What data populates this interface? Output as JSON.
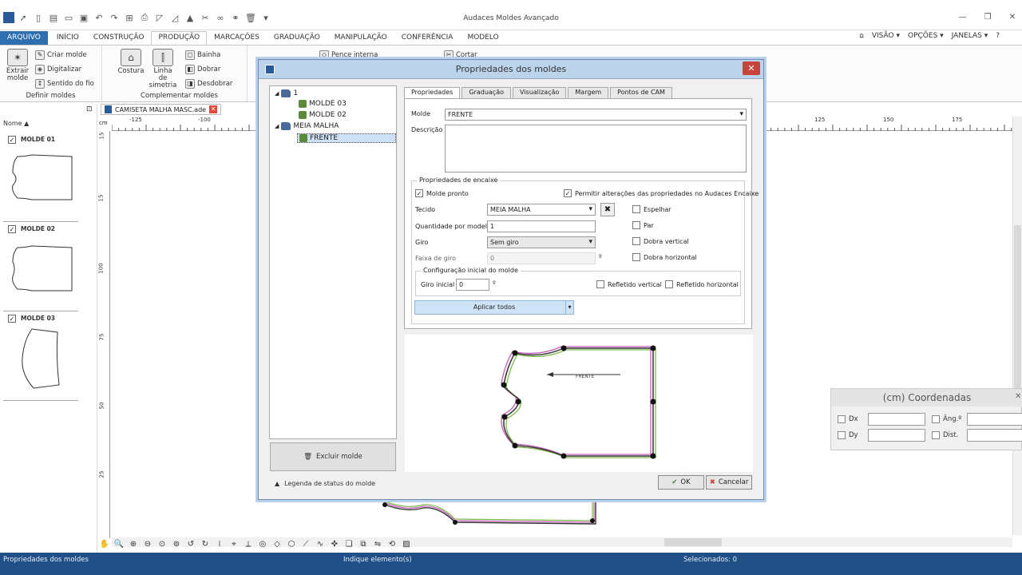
{
  "app": {
    "title": "Audaces Moldes Avançado",
    "quick_access_icons": [
      "pointer-icon",
      "new-icon",
      "open-icon",
      "folder-icon",
      "save-icon",
      "undo-icon",
      "redo-icon",
      "table-icon",
      "print-icon",
      "ruler-icon",
      "tape-icon",
      "shirt-icon",
      "scissors-icon",
      "glasses-icon",
      "link-icon",
      "delete-icon",
      "more-icon"
    ]
  },
  "ribbon": {
    "tabs": [
      "ARQUIVO",
      "INÍCIO",
      "CONSTRUÇÃO",
      "PRODUÇÃO",
      "MARCAÇÕES",
      "GRADUAÇÃO",
      "MANIPULAÇÃO",
      "CONFERÊNCIA",
      "MODELO"
    ],
    "active_tab": "PRODUÇÃO",
    "right_menu": [
      "VISÃO ▾",
      "OPÇÕES ▾",
      "JANELAS ▾"
    ],
    "groups": {
      "definir": {
        "label": "Definir moldes",
        "extrair": "Extrair molde",
        "criar": "Criar molde",
        "digitalizar": "Digitalizar",
        "sentido": "Sentido do fio"
      },
      "complementar": {
        "label": "Complementar moldes",
        "costura": "Costura",
        "simetria": "Linha de simetria",
        "bainha": "Bainha",
        "dobrar": "Dobrar",
        "desdobrar": "Desdobrar"
      },
      "extra": {
        "pence": "Pence interna",
        "cortar": "Cortar"
      }
    }
  },
  "document_tab": "CAMISETA MALHA MASC.ade",
  "left_panel": {
    "header": "Nome",
    "moldes": [
      {
        "label": "MOLDE 01",
        "checked": true
      },
      {
        "label": "MOLDE 02",
        "checked": true
      },
      {
        "label": "MOLDE 03",
        "checked": true
      }
    ]
  },
  "ruler": {
    "h_ticks": [
      "-125",
      "-100",
      "125",
      "150",
      "175"
    ],
    "v_ticks": [
      "15",
      "100",
      "75",
      "50",
      "25"
    ]
  },
  "coordinates": {
    "title": "(cm) Coordenadas",
    "dx": "Dx",
    "dy": "Dy",
    "ang": "Âng.º",
    "dist": "Dist."
  },
  "dialog": {
    "title": "Propriedades dos moldes",
    "tree": {
      "group1": "1",
      "molde03": "MOLDE 03",
      "molde02": "MOLDE 02",
      "group2": "MEIA MALHA",
      "frente": "FRENTE"
    },
    "excluir": "Excluir molde",
    "legenda": "Legenda de status do molde",
    "tabs": [
      "Propriedades",
      "Graduação",
      "Visualização",
      "Margem",
      "Pontos de CAM"
    ],
    "active_tab": "Propriedades",
    "molde_label": "Molde",
    "molde_value": "FRENTE",
    "descricao_label": "Descrição",
    "encaixe_title": "Propriedades de encaixe",
    "molde_pronto": "Molde pronto",
    "permitir": "Permitir alterações das propriedades no Audaces Encaixe",
    "tecido_label": "Tecido",
    "tecido_value": "MEIA MALHA",
    "quantidade_label": "Quantidade por modelo",
    "quantidade_value": "1",
    "giro_label": "Giro",
    "giro_value": "Sem giro",
    "faixa_label": "Faixa de giro",
    "faixa_value": "0",
    "degree": "º",
    "espelhar": "Espelhar",
    "par": "Par",
    "dobra_vertical": "Dobra vertical",
    "dobra_horizontal": "Dobra horizontal",
    "config_title": "Configuração inicial do molde",
    "giro_inicial_label": "Giro inicial",
    "giro_inicial_value": "0",
    "refletido_vertical": "Refletido vertical",
    "refletido_horizontal": "Refletido horizontal",
    "aplicar": "Aplicar todos",
    "preview_label": "FRENTE",
    "ok": "OK",
    "cancel": "Cancelar"
  },
  "status": {
    "left": "Propriedades dos moldes",
    "center": "Indique elemento(s)",
    "right": "Selecionados: 0"
  },
  "colors": {
    "file_tab": "#2f6fb0",
    "status_bar": "#1f4f86",
    "dialog_title": "#bcd3ec",
    "close": "#c8433a",
    "apply_button": "#cfe3f7"
  }
}
